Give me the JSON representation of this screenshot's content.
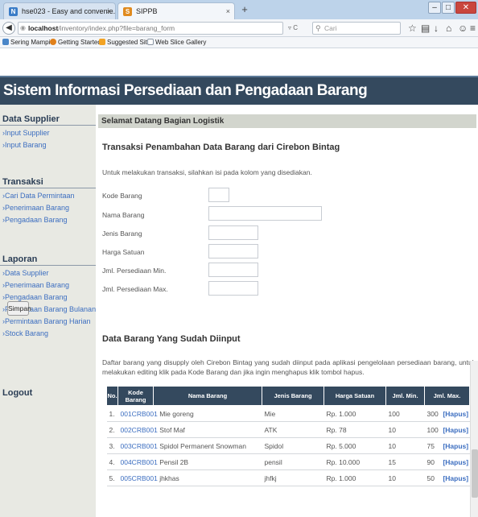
{
  "browser": {
    "tabs": [
      {
        "label": "hse023 - Easy and convenie...",
        "close": "×",
        "favicon": "N"
      },
      {
        "label": "SIPPB",
        "close": "×",
        "favicon": "S"
      }
    ],
    "new_tab": "+",
    "url_host": "localhost",
    "url_path": "/inventory/index.php?file=barang_form",
    "search_placeholder": "Cari",
    "bookmarks": [
      "Sering Mampir",
      "Getting Started",
      "Suggested Sites",
      "Web Slice Gallery"
    ]
  },
  "header": {
    "title": "Sistem Informasi Persediaan dan Pengadaan Barang"
  },
  "sidebar": {
    "sections": [
      {
        "title": "Data Supplier",
        "items": [
          "›Input Supplier",
          "›Input Barang"
        ]
      },
      {
        "title": "Transaksi",
        "items": [
          "›Cari Data Permintaan",
          "›Penerimaan Barang",
          "›Pengadaan Barang"
        ]
      },
      {
        "title": "Laporan",
        "items": [
          "›Data Supplier",
          "›Penerimaan Barang",
          "›Pengadaan Barang",
          "›Permintaan Barang Bulanan",
          "›Permintaan Barang Harian",
          "›Stock Barang"
        ]
      }
    ],
    "logout": "Logout"
  },
  "main": {
    "welcome": "Selamat Datang Bagian Logistik",
    "form_title": "Transaksi Penambahan Data Barang dari Cirebon Bintag",
    "intro": "Untuk melakukan transaksi, silahkan isi pada kolom yang disediakan.",
    "fields": [
      {
        "label": "Kode Barang",
        "value": ""
      },
      {
        "label": "Nama Barang",
        "value": ""
      },
      {
        "label": "Jenis Barang",
        "value": ""
      },
      {
        "label": "Harga Satuan",
        "value": ""
      },
      {
        "label": "Jml. Persediaan Min.",
        "value": ""
      },
      {
        "label": "Jml. Persediaan Max.",
        "value": ""
      }
    ],
    "submit_label": "Simpan",
    "table_title": "Data Barang Yang Sudah Diinput",
    "table_desc": "Daftar barang yang disupply oleh Cirebon Bintag yang sudah diinput pada aplikasi pengelolaan persediaan barang, untuk melakukan editing klik pada Kode Barang dan jika ingin menghapus klik tombol hapus.",
    "table": {
      "headers": [
        "No.",
        "Kode Barang",
        "Nama Barang",
        "Jenis Barang",
        "Harga Satuan",
        "Jml. Min.",
        "Jml. Max."
      ],
      "rows": [
        {
          "no": "1.",
          "kode": "001CRB001",
          "nama": "Mie goreng",
          "jenis": "Mie",
          "harga": "Rp. 1.000",
          "min": "100",
          "max": "300",
          "action": "[Hapus]"
        },
        {
          "no": "2.",
          "kode": "002CRB001",
          "nama": "Stof Maf",
          "jenis": "ATK",
          "harga": "Rp. 78",
          "min": "10",
          "max": "100",
          "action": "[Hapus]"
        },
        {
          "no": "3.",
          "kode": "003CRB001",
          "nama": "Spidol Permanent Snowman",
          "jenis": "Spidol",
          "harga": "Rp. 5.000",
          "min": "10",
          "max": "75",
          "action": "[Hapus]"
        },
        {
          "no": "4.",
          "kode": "004CRB001",
          "nama": "Pensil 2B",
          "jenis": "pensil",
          "harga": "Rp. 10.000",
          "min": "15",
          "max": "90",
          "action": "[Hapus]"
        },
        {
          "no": "5.",
          "kode": "005CRB001",
          "nama": "jhkhas",
          "jenis": "jhfkj",
          "harga": "Rp. 1.000",
          "min": "10",
          "max": "50",
          "action": "[Hapus]"
        }
      ]
    }
  },
  "colors": {
    "header_bg": "#34495e",
    "link": "#3c6ec0",
    "sidebar_bg": "#e8e9e3"
  }
}
